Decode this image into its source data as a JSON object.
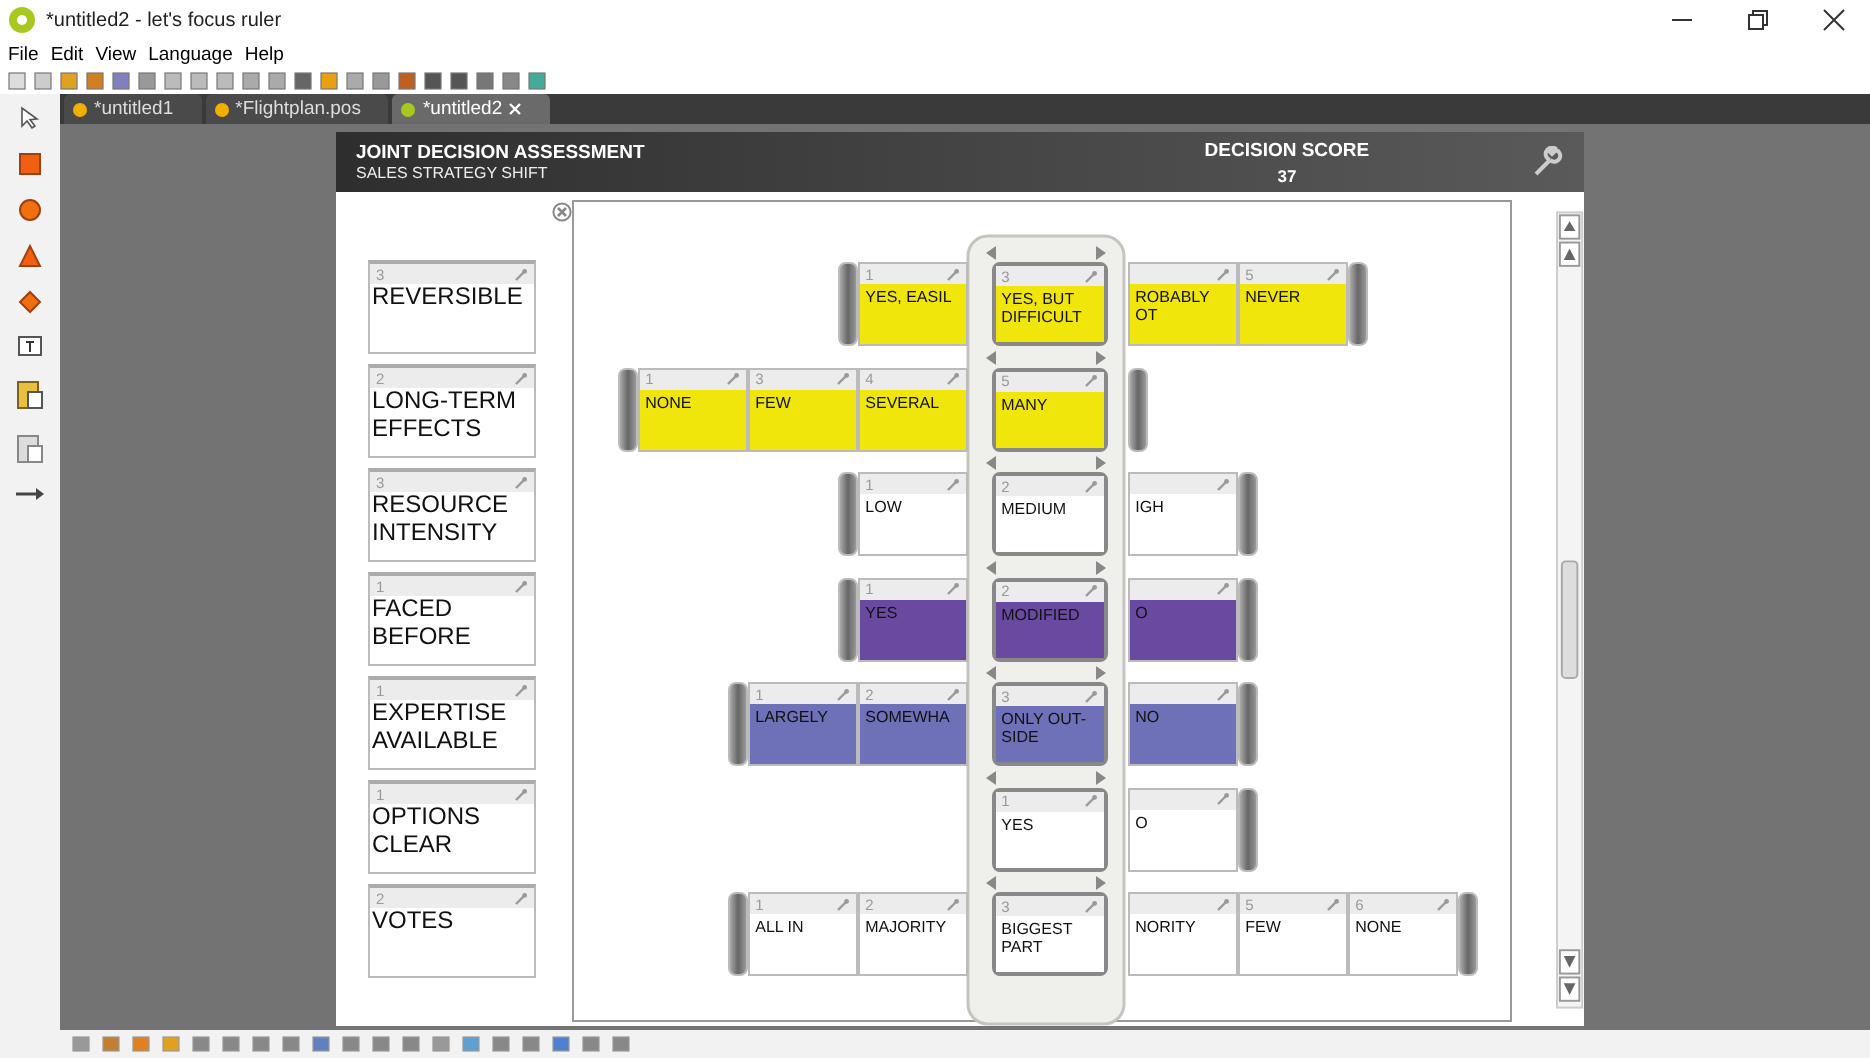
{
  "window": {
    "title": "*untitled2 - let's focus ruler"
  },
  "menu": [
    "File",
    "Edit",
    "View",
    "Language",
    "Help"
  ],
  "tabs": [
    {
      "label": "*untitled1",
      "selected": false
    },
    {
      "label": "*Flightplan.pos",
      "selected": false
    },
    {
      "label": "*untitled2",
      "selected": true
    }
  ],
  "header": {
    "title": "JOINT DECISION ASSESSMENT",
    "subtitle": "SALES STRATEGY SHIFT",
    "score_label": "DECISION SCORE",
    "score": "37"
  },
  "factors": [
    {
      "number": "3",
      "label": "REVERSIBLE"
    },
    {
      "number": "2",
      "label": "LONG-TERM EFFECTS"
    },
    {
      "number": "3",
      "label": "RESOURCE INTENSITY"
    },
    {
      "number": "1",
      "label": "FACED BEFORE"
    },
    {
      "number": "1",
      "label": "EXPERTISE AVAILABLE"
    },
    {
      "number": "1",
      "label": "OPTIONS CLEAR"
    },
    {
      "number": "2",
      "label": "VOTES"
    }
  ],
  "rows": [
    {
      "color": "#f0e60c",
      "cards": [
        {
          "number": "1",
          "label": "YES, EASIL",
          "selected": false
        },
        {
          "number": "3",
          "label": "YES, BUT DIFFICULT",
          "selected": true
        },
        {
          "label": "ROBABLY OT",
          "selected": false
        },
        {
          "number": "5",
          "label": "NEVER",
          "selected": false
        }
      ]
    },
    {
      "color": "#f0e60c",
      "cards": [
        {
          "number": "1",
          "label": "NONE",
          "selected": false
        },
        {
          "number": "3",
          "label": "FEW",
          "selected": false
        },
        {
          "number": "4",
          "label": "SEVERAL",
          "selected": false
        },
        {
          "number": "5",
          "label": "MANY",
          "selected": true
        }
      ]
    },
    {
      "color": "#ffffff",
      "cards": [
        {
          "number": "1",
          "label": "LOW",
          "selected": false
        },
        {
          "number": "2",
          "label": "MEDIUM",
          "selected": true
        },
        {
          "label": "IGH",
          "selected": false
        }
      ]
    },
    {
      "color": "#6a4aa0",
      "cards": [
        {
          "number": "1",
          "label": "YES",
          "selected": false
        },
        {
          "number": "2",
          "label": "MODIFIED",
          "selected": true
        },
        {
          "label": "O",
          "selected": false
        }
      ]
    },
    {
      "color": "#6e70b8",
      "cards": [
        {
          "number": "1",
          "label": "LARGELY",
          "selected": false
        },
        {
          "number": "2",
          "label": "SOMEWHA",
          "selected": false
        },
        {
          "number": "3",
          "label": "ONLY OUT-SIDE",
          "selected": true
        },
        {
          "label": "NO",
          "selected": false
        }
      ]
    },
    {
      "color": "#ffffff",
      "cards": [
        {
          "number": "1",
          "label": "YES",
          "selected": true
        },
        {
          "label": "O",
          "selected": false
        }
      ]
    },
    {
      "color": "#ffffff",
      "cards": [
        {
          "number": "1",
          "label": "ALL IN",
          "selected": false
        },
        {
          "number": "2",
          "label": "MAJORITY",
          "selected": false
        },
        {
          "number": "3",
          "label": "BIGGEST PART",
          "selected": true
        },
        {
          "label": "NORITY",
          "selected": false
        },
        {
          "number": "5",
          "label": "FEW",
          "selected": false
        },
        {
          "number": "6",
          "label": "NONE",
          "selected": false
        }
      ]
    }
  ]
}
